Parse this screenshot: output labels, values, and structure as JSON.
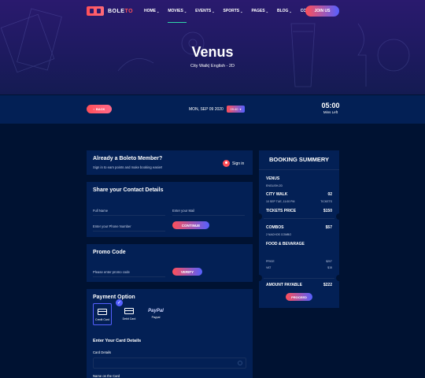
{
  "header": {
    "brand": {
      "accent": "BOLE",
      "rest": "TO"
    },
    "nav": [
      {
        "label": "HOME",
        "dropdown": true
      },
      {
        "label": "MOVIES",
        "dropdown": true,
        "active": true
      },
      {
        "label": "EVENTS",
        "dropdown": true
      },
      {
        "label": "SPORTS",
        "dropdown": true
      },
      {
        "label": "PAGES",
        "dropdown": true
      },
      {
        "label": "BLOG",
        "dropdown": true
      },
      {
        "label": "CONTACT",
        "dropdown": false
      }
    ],
    "join_label": "JOIN US"
  },
  "hero": {
    "title": "Venus",
    "subtitle": "City Walk| English - 2D"
  },
  "ticket_bar": {
    "back_label": "BACK",
    "date": "MON, SEP 09 2020",
    "time_value": "09:40",
    "timer_value": "05:00",
    "timer_label": "Mins Left"
  },
  "member": {
    "title": "Already a Boleto Member?",
    "text": "Sign in to earn points and make booking easier!",
    "signin_label": "Sign in"
  },
  "contact": {
    "title": "Share your Contact Details",
    "fullname_placeholder": "Full Name",
    "email_placeholder": "Enter your Mail",
    "phone_placeholder": "Enter your Phone Number",
    "continue_label": "CONTINUE"
  },
  "promo": {
    "title": "Promo Code",
    "placeholder": "Please enter promo code",
    "verify_label": "VERIFY"
  },
  "payment": {
    "title": "Payment Option",
    "options": [
      {
        "label": "Credit Card",
        "selected": true
      },
      {
        "label": "Debit Card",
        "selected": false
      },
      {
        "label": "Paypal",
        "brand": "PayPal",
        "selected": false
      }
    ],
    "card_section_title": "Enter Your Card Details",
    "card_details_label": "Card Details",
    "name_on_card_label": "Name on the Card"
  },
  "summary": {
    "title": "BOOKING SUMMERY",
    "movie": "VENUS",
    "movie_meta": "ENGLISH-2D",
    "venue": "CITY WALK",
    "venue_count": "02",
    "showtime": "10 SEP TUE, 11:00 PM",
    "tickets_label": "TICKETS",
    "ticket_price_label": "TICKETS PRICE",
    "ticket_price": "$150",
    "combos_label": "COMBOS",
    "combos_price": "$57",
    "combo_item": "2 NACHOS COMBO",
    "food_label": "FOOD & BEVARAGE",
    "price_label": "PRICE",
    "price_value": "$207",
    "vat_label": "VAT",
    "vat_value": "$15",
    "amount_label": "AMOUNT PAYABLE",
    "amount_value": "$222",
    "proceed_label": "PROCEED"
  },
  "colors": {
    "bg": "#001232",
    "card": "#032055",
    "accent_pink": "#ff4f58",
    "accent_blue": "#5560ff",
    "active_nav": "#31d7a9"
  }
}
